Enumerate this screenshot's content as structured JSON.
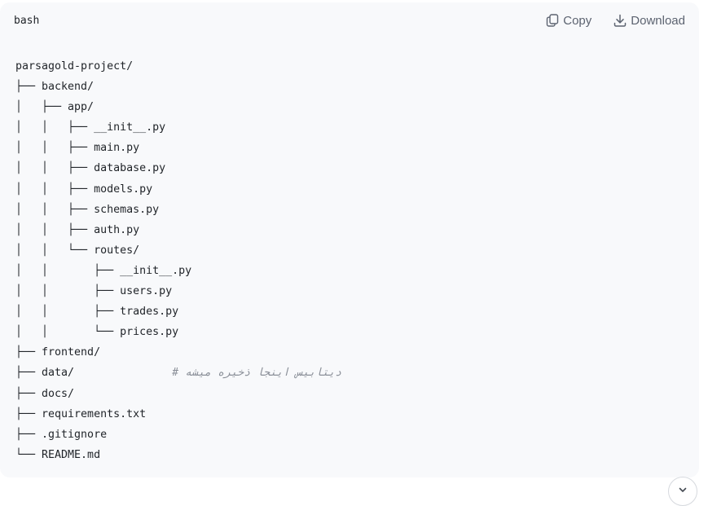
{
  "code_block": {
    "language": "bash",
    "copy_label": "Copy",
    "download_label": "Download",
    "lines": [
      {
        "text": "parsagold-project/",
        "comment": ""
      },
      {
        "text": "├── backend/",
        "comment": ""
      },
      {
        "text": "│   ├── app/",
        "comment": ""
      },
      {
        "text": "│   │   ├── __init__.py",
        "comment": ""
      },
      {
        "text": "│   │   ├── main.py",
        "comment": ""
      },
      {
        "text": "│   │   ├── database.py",
        "comment": ""
      },
      {
        "text": "│   │   ├── models.py",
        "comment": ""
      },
      {
        "text": "│   │   ├── schemas.py",
        "comment": ""
      },
      {
        "text": "│   │   ├── auth.py",
        "comment": ""
      },
      {
        "text": "│   │   └── routes/",
        "comment": ""
      },
      {
        "text": "│   │       ├── __init__.py",
        "comment": ""
      },
      {
        "text": "│   │       ├── users.py",
        "comment": ""
      },
      {
        "text": "│   │       ├── trades.py",
        "comment": ""
      },
      {
        "text": "│   │       └── prices.py",
        "comment": ""
      },
      {
        "text": "├── frontend/",
        "comment": ""
      },
      {
        "text": "├── data/",
        "comment": "               # دیتابیس اینجا ذخیره میشه"
      },
      {
        "text": "├── docs/",
        "comment": ""
      },
      {
        "text": "├── requirements.txt",
        "comment": ""
      },
      {
        "text": "├── .gitignore",
        "comment": ""
      },
      {
        "text": "└── README.md",
        "comment": ""
      }
    ]
  },
  "icons": {
    "copy": "copy-icon",
    "download": "download-icon",
    "scroll_down": "chevron-down-icon"
  },
  "colors": {
    "code_background": "#f8f9fb",
    "text": "#1f2328",
    "muted": "#5c6370",
    "comment": "#8a8f98"
  }
}
